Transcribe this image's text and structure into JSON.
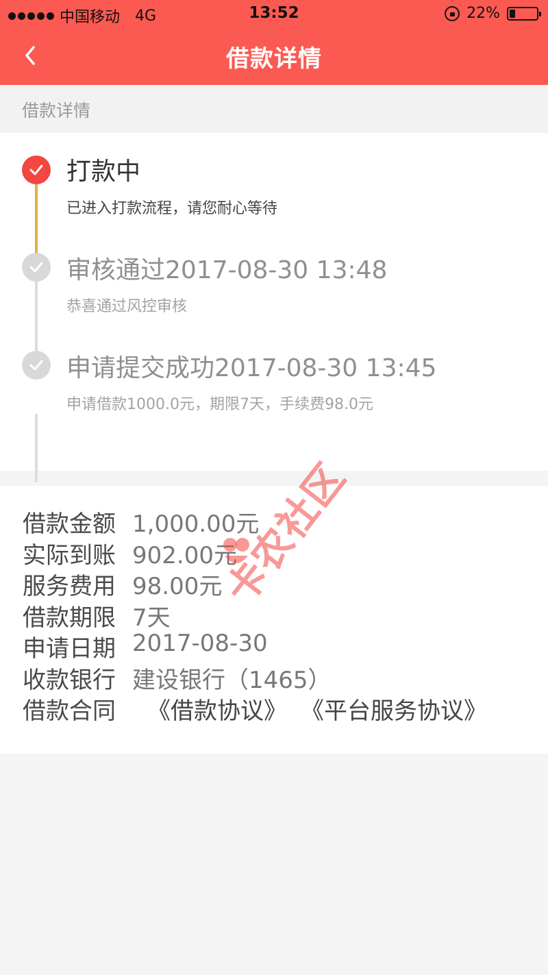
{
  "status_bar": {
    "carrier": "中国移动",
    "network": "4G",
    "time": "13:52",
    "battery_percent": "22%",
    "battery_level": 0.22
  },
  "nav": {
    "title": "借款详情",
    "back_icon": "chevron-left-icon"
  },
  "section_title": "借款详情",
  "timeline": [
    {
      "title": "打款中",
      "desc": "已进入打款流程，请您耐心等待",
      "state": "active"
    },
    {
      "title": "审核通过2017-08-30 13:48",
      "desc": "恭喜通过风控审核",
      "state": "done"
    },
    {
      "title": "申请提交成功2017-08-30 13:45",
      "desc": "申请借款1000.0元，期限7天，手续费98.0元",
      "state": "done"
    }
  ],
  "details": {
    "loan_amount": {
      "label": "借款金额",
      "value": "1,000.00元"
    },
    "actual_received": {
      "label": "实际到账",
      "value": "902.00元"
    },
    "service_fee": {
      "label": "服务费用",
      "value": "98.00元"
    },
    "loan_term": {
      "label": "借款期限",
      "value": "7天"
    },
    "apply_date": {
      "label": "申请日期",
      "value": "2017-08-30"
    },
    "bank": {
      "label": "收款银行",
      "value": "建设银行（1465）"
    },
    "contract": {
      "label": "借款合同",
      "link1": "《借款协议》",
      "link2": "《平台服务协议》"
    }
  },
  "watermark": "卡农社区",
  "colors": {
    "header": "#fb5a52",
    "active_dot": "#f3473f",
    "active_line": "#e4b040",
    "inactive_dot": "#d8d8d8"
  }
}
